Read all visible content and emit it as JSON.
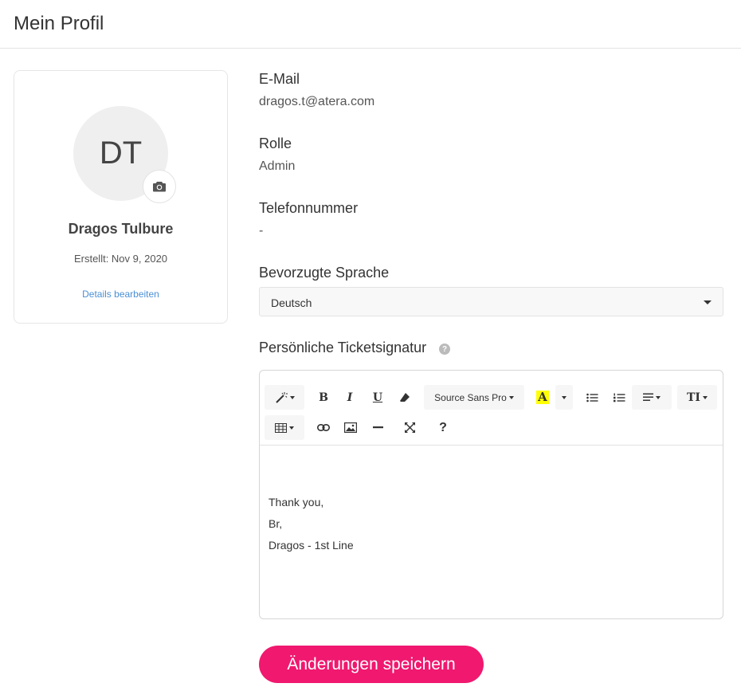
{
  "header": {
    "title": "Mein Profil"
  },
  "profile": {
    "initials": "DT",
    "name": "Dragos Tulbure",
    "created": "Erstellt: Nov 9, 2020",
    "edit_link": "Details bearbeiten"
  },
  "fields": {
    "email": {
      "label": "E-Mail",
      "value": "dragos.t@atera.com"
    },
    "role": {
      "label": "Rolle",
      "value": "Admin"
    },
    "phone": {
      "label": "Telefonnummer",
      "value": "-"
    },
    "language": {
      "label": "Bevorzugte Sprache",
      "selected": "Deutsch"
    },
    "signature": {
      "label": "Persönliche Ticketsignatur",
      "help_icon": "?"
    }
  },
  "editor": {
    "toolbar": {
      "font_name": "Source Sans Pro",
      "bold_label": "B",
      "italic_label": "I",
      "underline_label": "U",
      "font_size_label": "TI",
      "help_label": "?",
      "highlight_label": "A",
      "highlight_color": "#ffff00"
    },
    "lines": [
      "Thank you,",
      "Br,",
      "Dragos - 1st Line"
    ]
  },
  "actions": {
    "save_label": "Änderungen speichern"
  },
  "colors": {
    "accent": "#f0186f",
    "link": "#4a8fd4"
  }
}
